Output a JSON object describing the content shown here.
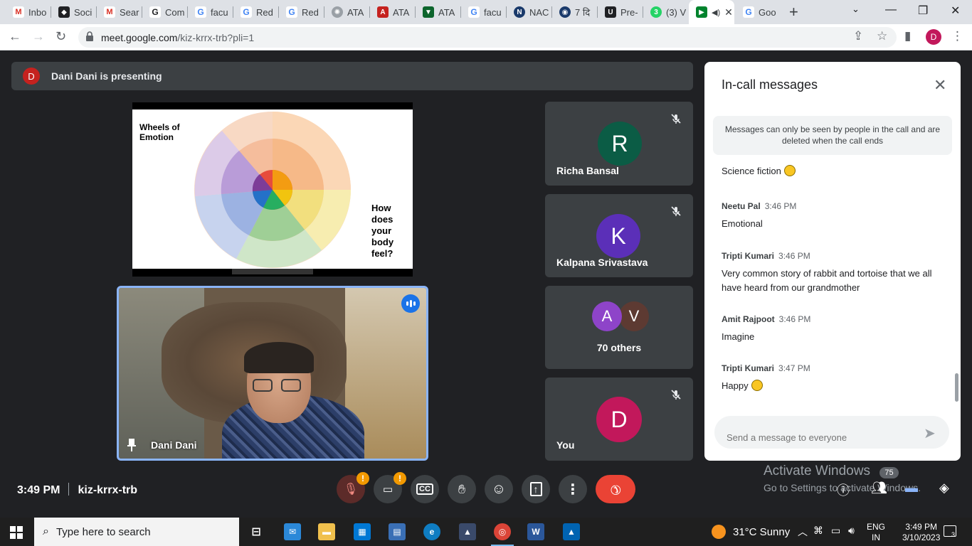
{
  "browser": {
    "tabs": [
      {
        "label": "Inbo",
        "icon": "gmail-icon",
        "color": "#d93025"
      },
      {
        "label": "Soci",
        "icon": "social-icon",
        "color": "#202124"
      },
      {
        "label": "Sear",
        "icon": "gmail-icon",
        "color": "#d93025"
      },
      {
        "label": "Com",
        "icon": "google-icon",
        "color": "#202124"
      },
      {
        "label": "facu",
        "icon": "google-icon",
        "color": "#4285f4"
      },
      {
        "label": "Red",
        "icon": "google-icon",
        "color": "#4285f4"
      },
      {
        "label": "Red",
        "icon": "google-icon",
        "color": "#4285f4"
      },
      {
        "label": "ATA",
        "icon": "atal-icon",
        "color": "#9aa0a6"
      },
      {
        "label": "ATA",
        "icon": "atal-icon",
        "color": "#c5221f"
      },
      {
        "label": "ATA",
        "icon": "shield-icon",
        "color": "#0d652d"
      },
      {
        "label": "facu",
        "icon": "google-icon",
        "color": "#4285f4"
      },
      {
        "label": "NAC",
        "icon": "nac-icon",
        "color": "#1a3a6b"
      },
      {
        "label": "7 दि",
        "icon": "globe-icon",
        "color": "#1a3a6b"
      },
      {
        "label": "Pre-",
        "icon": "letter-u-icon",
        "color": "#202124"
      },
      {
        "label": "(3) V",
        "icon": "whatsapp-icon",
        "color": "#25d366"
      },
      {
        "label": "",
        "icon": "meet-icon",
        "color": "#00832d",
        "active": true
      },
      {
        "label": "Goo",
        "icon": "google-icon",
        "color": "#4285f4"
      }
    ],
    "url_main": "meet.google.com",
    "url_path": "/kiz-krrx-trb?pli=1",
    "profile_initial": "D"
  },
  "meet": {
    "presenting_avatar": "D",
    "presenting_text": "Dani Dani is presenting",
    "slide": {
      "title_line1": "Wheels of",
      "title_line2": "Emotion",
      "question": [
        "How",
        "does",
        "your",
        "body",
        "feel?"
      ]
    },
    "main_video_name": "Dani Dani",
    "tiles": [
      {
        "initial": "R",
        "name": "Richa Bansal",
        "color": "#0b5c45"
      },
      {
        "initial": "K",
        "name": "Kalpana Srivastava",
        "color": "#5b2fb8"
      },
      {
        "initials": [
          "A",
          "V"
        ],
        "colors": [
          "#8e44c9",
          "#5d3a32"
        ],
        "name": "70 others"
      },
      {
        "initial": "D",
        "name": "You",
        "color": "#c2185b"
      }
    ],
    "time": "3:49 PM",
    "meeting_code": "kiz-krrx-trb",
    "mic_warning": "!",
    "cam_warning": "!",
    "participant_count": "75",
    "activate_line1": "Activate Windows",
    "activate_line2": "Go to Settings to activate Windows."
  },
  "chat": {
    "title": "In-call messages",
    "notice": "Messages can only be seen by people in the call and are deleted when the call ends",
    "messages": [
      {
        "sender": "",
        "time": "",
        "text": "Science fiction"
      },
      {
        "sender": "Neetu Pal",
        "time": "3:46 PM",
        "text": "Emotional"
      },
      {
        "sender": "Tripti Kumari",
        "time": "3:46 PM",
        "text": "Very common story of rabbit and tortoise that we all have heard from our grandmother"
      },
      {
        "sender": "Amit Rajpoot",
        "time": "3:46 PM",
        "text": "Imagine"
      },
      {
        "sender": "Tripti Kumari",
        "time": "3:47 PM",
        "text": "Happy"
      }
    ],
    "input_placeholder": "Send a message to everyone"
  },
  "taskbar": {
    "search_placeholder": "Type here to search",
    "weather": "31°C  Sunny",
    "lang_line1": "ENG",
    "lang_line2": "IN",
    "time": "3:49 PM",
    "date": "3/10/2023",
    "notifications": "3"
  }
}
